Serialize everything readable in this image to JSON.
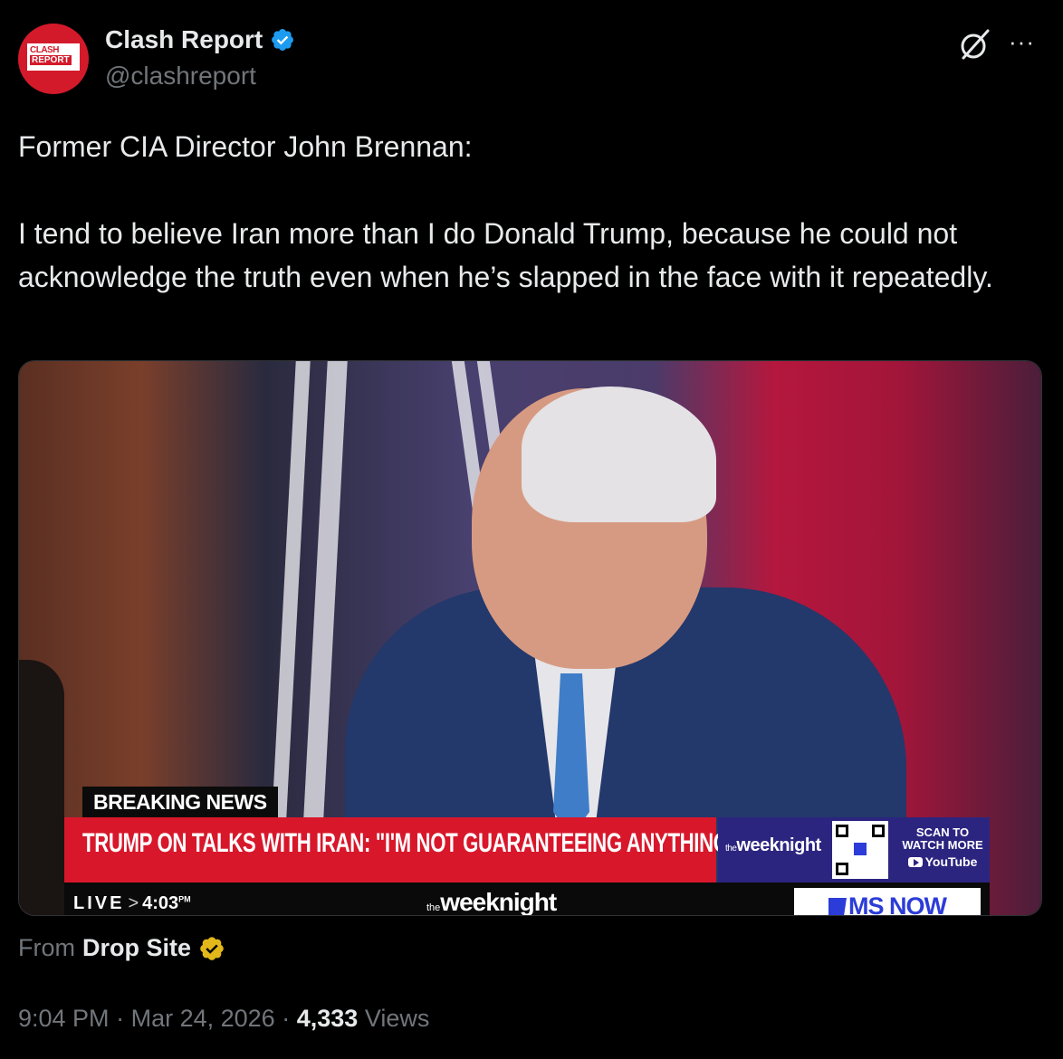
{
  "author": {
    "avatar_line1": "CLASH",
    "avatar_line2": "REPORT",
    "display_name": "Clash Report",
    "handle": "@clashreport",
    "verified_color": "#1d9bf0"
  },
  "tweet": {
    "line1": "Former CIA Director John Brennan:",
    "line2": "I tend to believe Iran more than I do Donald Trump, because he could not acknowledge the truth even when he’s slapped in the face with it repeatedly."
  },
  "video": {
    "breaking_label": "BREAKING NEWS",
    "headline": "TRUMP ON TALKS WITH IRAN: \"I'M NOT GUARANTEEING ANYTHING\"",
    "side_brand": "weeknight",
    "side_brand_prefix": "the",
    "scan_line1": "SCAN TO",
    "scan_line2": "WATCH MORE",
    "youtube": "YouTube",
    "live": "LIVE",
    "time": "4:03",
    "time_suffix_top": "PM",
    "time_suffix_bottom": "PT",
    "ticker_brand_prefix": "the",
    "ticker_brand": "weeknight",
    "network": "MS NOW"
  },
  "source": {
    "from": "From",
    "name": "Drop Site",
    "badge_color": "#e2b719"
  },
  "meta": {
    "time": "9:04 PM",
    "sep1": "·",
    "date": "Mar 24, 2026",
    "sep2": "·",
    "views_count": "4,333",
    "views_label": "Views"
  },
  "icons": [
    "grok-icon",
    "more-icon",
    "verified-icon",
    "gold-verified-icon"
  ]
}
